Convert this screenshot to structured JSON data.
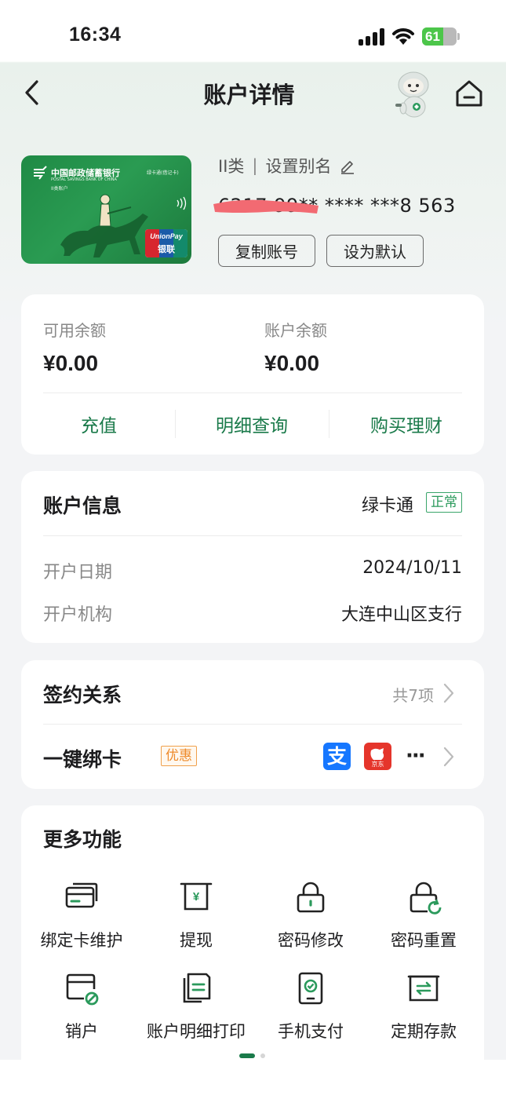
{
  "status_bar": {
    "time": "16:34",
    "battery": "61",
    "battery_level": 0.61
  },
  "nav": {
    "title": "账户详情"
  },
  "card": {
    "bank_name": "中国邮政储蓄银行",
    "bank_name_en": "POSTAL SAVINGS BANK OF CHINA",
    "card_class_label": "II类账户",
    "card_product": "绿卡通(借记卡)",
    "union_pay": "UnionPay",
    "union_pay_cn": "银联",
    "account_class": "II类",
    "alias_label": "设置别名",
    "account_number": "6217 99** **** ***8 563",
    "copy_button": "复制账号",
    "default_button": "设为默认"
  },
  "balance": {
    "available_label": "可用余额",
    "available_value": "¥0.00",
    "account_label": "账户余额",
    "account_value": "¥0.00",
    "actions": [
      "充值",
      "明细查询",
      "购买理财"
    ]
  },
  "account_info": {
    "title": "账户信息",
    "card_type": "绿卡通",
    "status": "正常",
    "open_date_label": "开户日期",
    "open_date_value": "2024/10/11",
    "branch_label": "开户机构",
    "branch_value": "大连中山区支行"
  },
  "contracts": {
    "title": "签约关系",
    "count": "共7项",
    "bind_label": "一键绑卡",
    "promo_badge": "优惠",
    "more": "···",
    "apps": [
      "alipay-icon",
      "jd-icon"
    ],
    "app_labels": {
      "alipay": "支",
      "jd": "京东"
    }
  },
  "more_functions": {
    "title": "更多功能",
    "items": [
      {
        "label": "绑定卡维护",
        "icon": "card-maintenance-icon"
      },
      {
        "label": "提现",
        "icon": "withdraw-icon"
      },
      {
        "label": "密码修改",
        "icon": "lock-icon"
      },
      {
        "label": "密码重置",
        "icon": "lock-reset-icon"
      },
      {
        "label": "销户",
        "icon": "close-account-icon"
      },
      {
        "label": "账户明细打印",
        "icon": "print-detail-icon"
      },
      {
        "label": "手机支付",
        "icon": "mobile-pay-icon"
      },
      {
        "label": "定期存款",
        "icon": "fixed-deposit-icon"
      }
    ]
  },
  "colors": {
    "accent": "#1a7a4a",
    "promo": "#ee8a2a",
    "card_green": "#1f8a45"
  }
}
